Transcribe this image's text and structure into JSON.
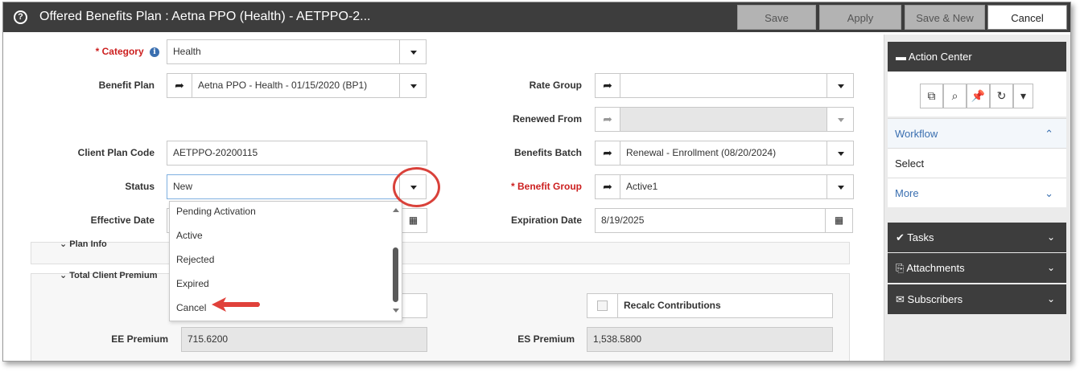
{
  "window": {
    "title": "Offered Benefits Plan : Aetna PPO (Health) - AETPPO-2...",
    "buttons": {
      "save": "Save",
      "apply": "Apply",
      "save_new": "Save & New",
      "cancel": "Cancel"
    }
  },
  "form": {
    "category": {
      "label": "Category",
      "required_mark": "*",
      "value": "Health"
    },
    "benefit_plan": {
      "label": "Benefit Plan",
      "value": "Aetna PPO - Health - 01/15/2020 (BP1)"
    },
    "rate_group": {
      "label": "Rate Group",
      "value": ""
    },
    "renewed_from": {
      "label": "Renewed From",
      "value": ""
    },
    "client_plan_code": {
      "label": "Client Plan Code",
      "value": "AETPPO-20200115"
    },
    "benefits_batch": {
      "label": "Benefits Batch",
      "value": "Renewal - Enrollment (08/20/2024)"
    },
    "status": {
      "label": "Status",
      "value": "New"
    },
    "benefit_group": {
      "label": "Benefit Group",
      "required_mark": "*",
      "value": "Active1"
    },
    "effective_date": {
      "label": "Effective Date",
      "value": ""
    },
    "expiration_date": {
      "label": "Expiration Date",
      "value": "8/19/2025"
    },
    "plan_info": {
      "title": "Plan Info"
    },
    "total_client_premium": {
      "title": "Total Client Premium"
    },
    "recalc": {
      "label": "Recalc Contributions"
    },
    "ee_premium": {
      "label": "EE Premium",
      "value": "715.6200"
    },
    "es_premium": {
      "label": "ES Premium",
      "value": "1,538.5800"
    }
  },
  "status_dropdown": {
    "options": [
      "Pending Activation",
      "Active",
      "Rejected",
      "Expired",
      "Cancel"
    ]
  },
  "action_center": {
    "title": "Action Center",
    "tools": [
      "external-link-icon",
      "search-icon",
      "pin-icon",
      "refresh-icon",
      "chevron-down-icon"
    ],
    "workflow": {
      "title": "Workflow",
      "select": "Select",
      "more": "More"
    },
    "tasks": "Tasks",
    "attachments": "Attachments",
    "subscribers": "Subscribers"
  },
  "colors": {
    "titlebar": "#3d3d3d",
    "required": "#cc1f1f",
    "annotation": "#d9413a",
    "link": "#3a6fb0"
  }
}
